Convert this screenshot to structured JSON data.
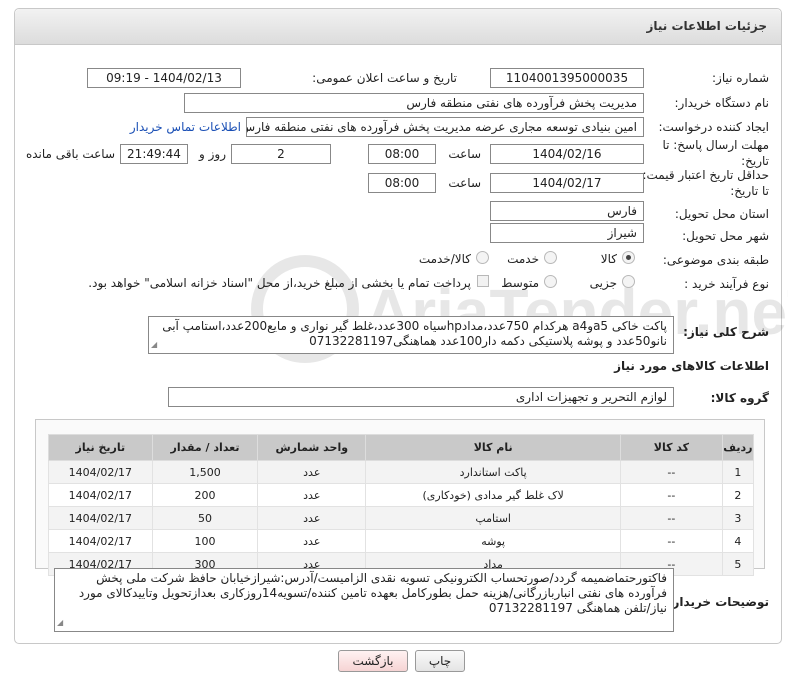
{
  "header": {
    "title": "جزئیات اطلاعات نیاز"
  },
  "fields": {
    "need_number_label": "شماره نیاز:",
    "need_number": "1104001395000035",
    "announce_label": "تاریخ و ساعت اعلان عمومی:",
    "announce_value": "1404/02/13 - 09:19",
    "buyer_org_label": "نام دستگاه خریدار:",
    "buyer_org": "مدیریت پخش فرآورده های نفتی منطقه فارس",
    "creator_label": "ایجاد کننده درخواست:",
    "creator": "امین بنیادی توسعه مجاری عرضه مدیریت پخش فرآورده های نفتی منطقه فارس",
    "contact_link": "اطلاعات تماس خریدار",
    "reply_deadline_label_1": "مهلت ارسال پاسخ: تا",
    "reply_deadline_label_2": "تاریخ:",
    "reply_date": "1404/02/16",
    "time_label": "ساعت",
    "reply_time": "08:00",
    "days_value": "2",
    "days_label": "روز و",
    "remaining_time": "21:49:44",
    "remaining_label": "ساعت باقی مانده",
    "validity_label_1": "حداقل تاریخ اعتبار قیمت:",
    "validity_label_2": "تا تاریخ:",
    "validity_date": "1404/02/17",
    "validity_time": "08:00",
    "province_label": "استان محل تحویل:",
    "province": "فارس",
    "city_label": "شهر محل تحویل:",
    "city": "شیراز",
    "category_label": "طبقه بندی موضوعی:",
    "category_options": [
      "کالا",
      "خدمت",
      "کالا/خدمت"
    ],
    "category_selected": "کالا",
    "process_label": "نوع فرآیند خرید :",
    "process_options": [
      "جزیی",
      "متوسط"
    ],
    "payment_note": "پرداخت تمام یا بخشی از مبلغ خرید،از محل \"اسناد خزانه اسلامی\" خواهد بود."
  },
  "description": {
    "label": "شرح کلی نیاز:",
    "text": "پاکت خاکی a5وa4 هرکدام 750عدد،مدادhpسیاه 300عدد،غلط گیر نواری و مایع200عدد،استامپ آبی نانو50عدد و پوشه پلاستیکی دکمه دار100عدد هماهنگی07132281197"
  },
  "goods": {
    "section_title": "اطلاعات کالاهای مورد نیاز",
    "group_label": "گروه کالا:",
    "group_value": "لوازم التحریر و تجهیزات اداری",
    "columns": [
      "ردیف",
      "کد کالا",
      "نام کالا",
      "واحد شمارش",
      "تعداد / مقدار",
      "تاریخ نیاز"
    ],
    "rows": [
      {
        "idx": "1",
        "code": "--",
        "name": "پاکت استاندارد",
        "unit": "عدد",
        "qty": "1,500",
        "date": "1404/02/17"
      },
      {
        "idx": "2",
        "code": "--",
        "name": "لاک غلط گیر مدادی (خودکاری)",
        "unit": "عدد",
        "qty": "200",
        "date": "1404/02/17"
      },
      {
        "idx": "3",
        "code": "--",
        "name": "استامپ",
        "unit": "عدد",
        "qty": "50",
        "date": "1404/02/17"
      },
      {
        "idx": "4",
        "code": "--",
        "name": "پوشه",
        "unit": "عدد",
        "qty": "100",
        "date": "1404/02/17"
      },
      {
        "idx": "5",
        "code": "--",
        "name": "مداد",
        "unit": "عدد",
        "qty": "300",
        "date": "1404/02/17"
      }
    ]
  },
  "buyer_notes": {
    "label": "توضیحات خریدار:",
    "text": "فاکتورحتماضمیمه گردد/صورتحساب الکترونیکی تسویه نقدی الزامیست/آدرس:شیرازخیابان حافظ شرکت ملی پخش فرآورده های نفتی انباربازرگانی/هزینه حمل بطورکامل بعهده تامین کننده/تسویه14روزکاری بعدازتحویل وتاییدکالای مورد نیاز/تلفن هماهنگی 07132281197"
  },
  "buttons": {
    "print": "چاپ",
    "back": "بازگشت"
  },
  "watermark": "AriaTender.net"
}
